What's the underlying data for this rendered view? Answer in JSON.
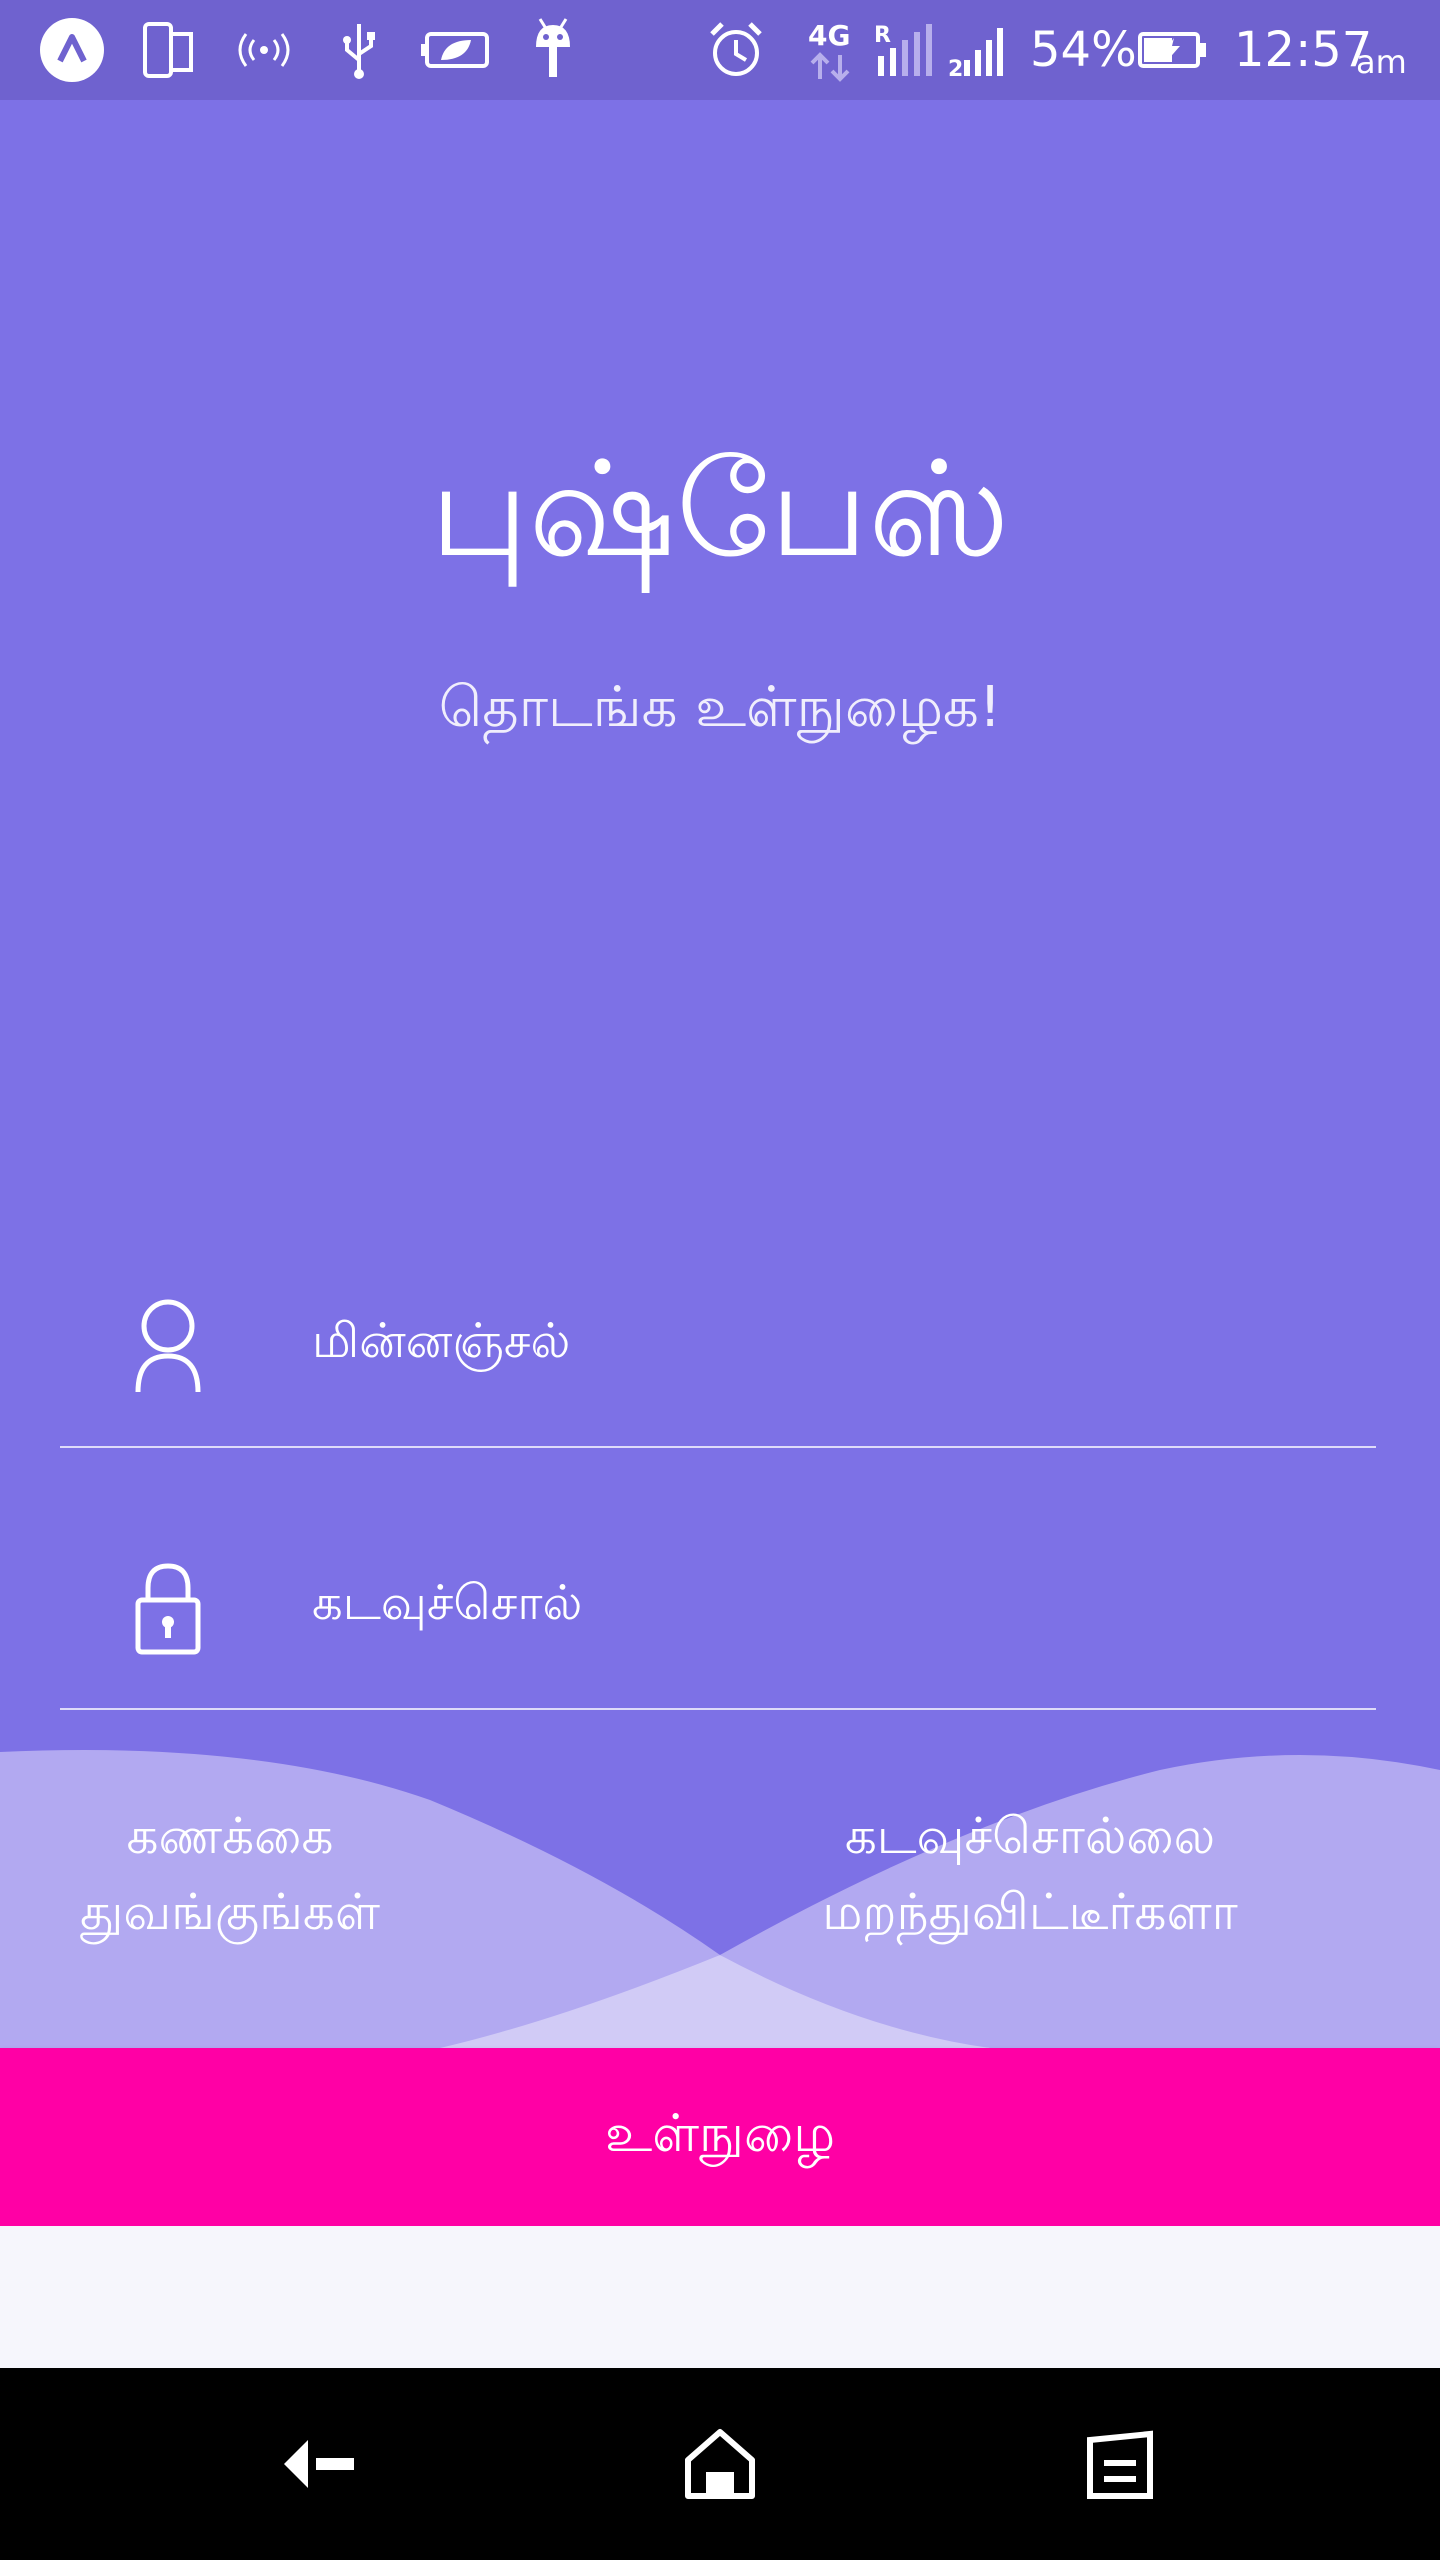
{
  "status_bar": {
    "battery_percent": "54%",
    "time": "12:57",
    "am_pm": "am",
    "network_type": "4G"
  },
  "header": {
    "title": "புஷ்பேஸ்",
    "subtitle": "தொடங்க உள்நுழைக!"
  },
  "form": {
    "email_placeholder": "மின்னஞ்சல்",
    "password_placeholder": "கடவுச்சொல்"
  },
  "links": {
    "create_account_line1": "கணக்கை",
    "create_account_line2": "துவங்குங்கள்",
    "forgot_password_line1": "கடவுச்சொல்லை",
    "forgot_password_line2": "மறந்துவிட்டீர்களா"
  },
  "login_button": {
    "label": "உள்நுழை"
  },
  "colors": {
    "primary": "#7d71e6",
    "status_bar": "#6f62cf",
    "accent": "#ff00a5",
    "wave_light": "#b2a9f1",
    "wave_pale": "#d1cbf6",
    "background_light": "#f6f6fc"
  },
  "icons": {
    "user": "person-outline-icon",
    "password": "lock-icon",
    "nav_back": "back-icon",
    "nav_home": "home-icon",
    "nav_recent": "recent-apps-icon"
  }
}
